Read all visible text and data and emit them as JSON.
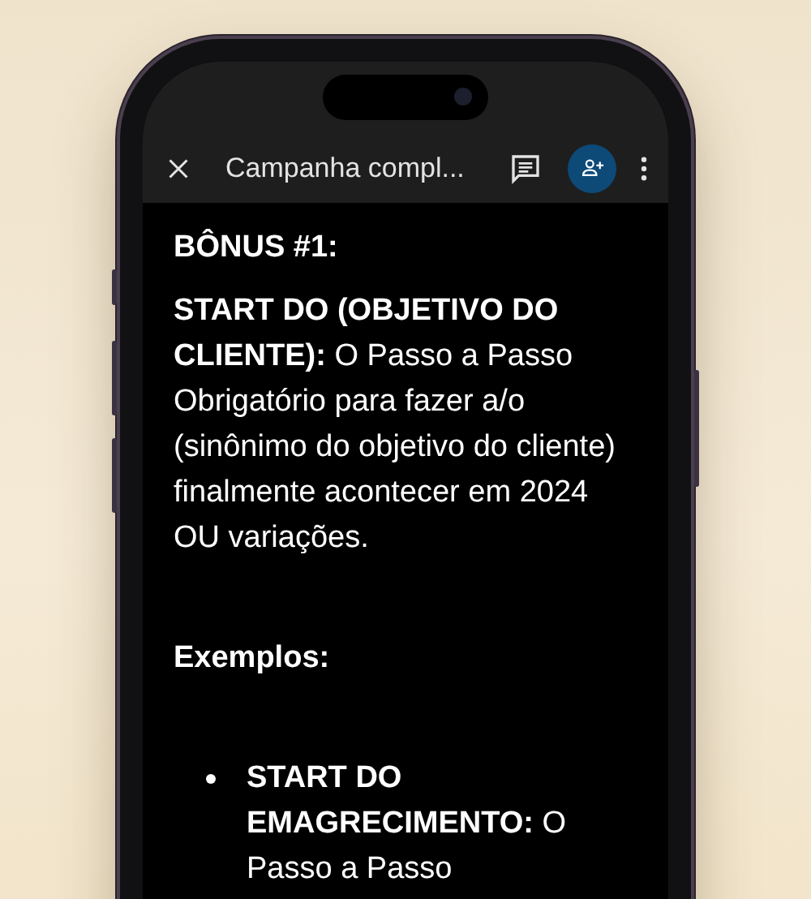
{
  "toolbar": {
    "title": "Campanha compl..."
  },
  "document": {
    "heading": "BÔNUS #1:",
    "paragraph": "**START DO (OBJETIVO DO CLIENTE):** O Passo a Passo Obrigatório para fazer a/o (sinônimo do objetivo do cliente) finalmente acontecer em 2024 OU variações.",
    "examples_label": "Exemplos:",
    "bullets": [
      "**START DO EMAGRECIMENTO:** O Passo a Passo"
    ]
  }
}
